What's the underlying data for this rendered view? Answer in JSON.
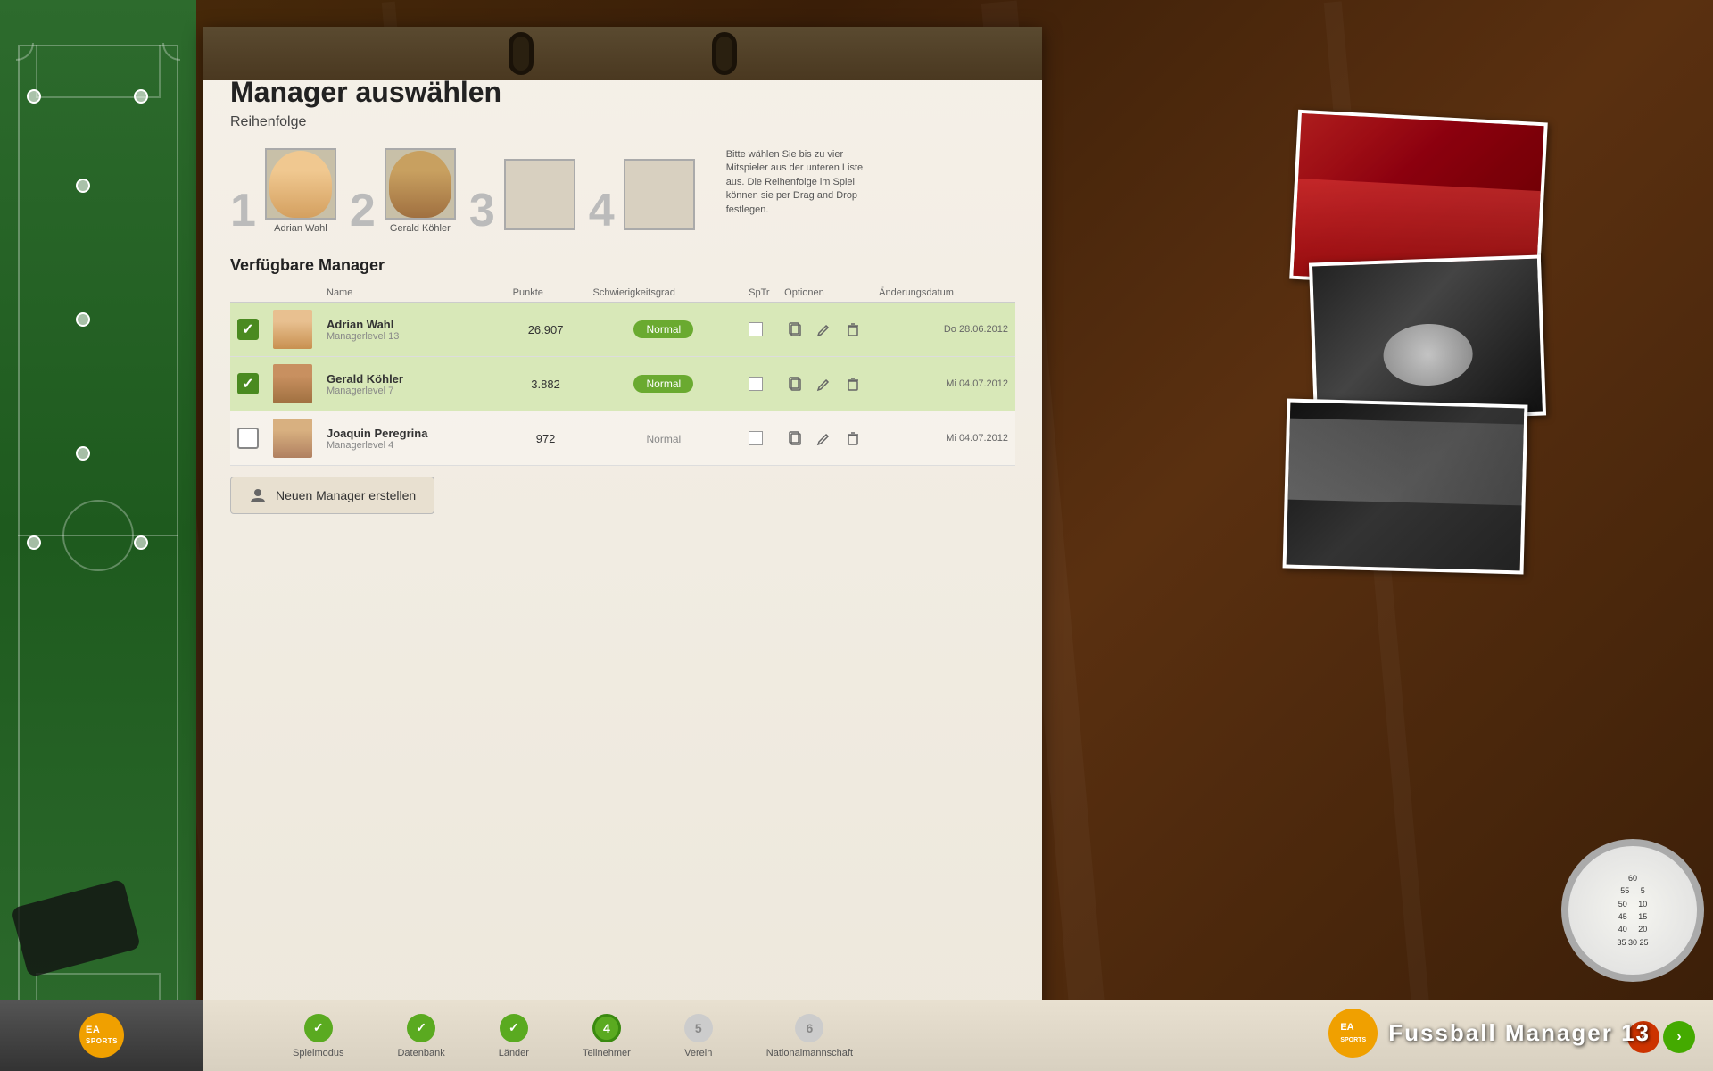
{
  "app": {
    "title": "Fussball Manager 13",
    "ea_sports": "EA SPORTS"
  },
  "page": {
    "title": "Manager auswählen",
    "subtitle": "Reihenfolge",
    "hint_text": "Bitte wählen Sie bis zu vier Mitspieler aus der unteren Liste aus. Die Reihenfolge im Spiel können sie per Drag and Drop festlegen."
  },
  "selection_slots": [
    {
      "number": "1",
      "name": "Adrian Wahl",
      "filled": true
    },
    {
      "number": "2",
      "name": "Gerald Köhler",
      "filled": true
    },
    {
      "number": "3",
      "name": "",
      "filled": false
    },
    {
      "number": "4",
      "name": "",
      "filled": false
    }
  ],
  "table": {
    "headers": {
      "name": "Name",
      "punkte": "Punkte",
      "schwierigkeit": "Schwierigkeitsgrad",
      "sptr": "SpTr",
      "optionen": "Optionen",
      "datum": "Änderungsdatum"
    },
    "rows": [
      {
        "selected": true,
        "checked": true,
        "name": "Adrian Wahl",
        "level": "Managerlevel 13",
        "punkte": "26.907",
        "schwierigkeit": "Normal",
        "schwierigkeit_style": "badge",
        "sptr": "",
        "date": "Do 28.06.2012"
      },
      {
        "selected": true,
        "checked": true,
        "name": "Gerald Köhler",
        "level": "Managerlevel 7",
        "punkte": "3.882",
        "schwierigkeit": "Normal",
        "schwierigkeit_style": "badge",
        "sptr": "",
        "date": "Mi 04.07.2012"
      },
      {
        "selected": false,
        "checked": false,
        "name": "Joaquin Peregrina",
        "level": "Managerlevel 4",
        "punkte": "972",
        "schwierigkeit": "Normal",
        "schwierigkeit_style": "plain",
        "sptr": "",
        "date": "Mi 04.07.2012"
      }
    ]
  },
  "create_button": "Neuen Manager erstellen",
  "nav_steps": [
    {
      "number": "✓",
      "label": "Spielmodus",
      "state": "done"
    },
    {
      "number": "✓",
      "label": "Datenbank",
      "state": "done"
    },
    {
      "number": "✓",
      "label": "Länder",
      "state": "done"
    },
    {
      "number": "4",
      "label": "Teilnehmer",
      "state": "active"
    },
    {
      "number": "5",
      "label": "Verein",
      "state": "inactive"
    },
    {
      "number": "6",
      "label": "Nationalmannschaft",
      "state": "inactive"
    }
  ],
  "nav_arrows": {
    "prev": "‹",
    "next": "›"
  }
}
